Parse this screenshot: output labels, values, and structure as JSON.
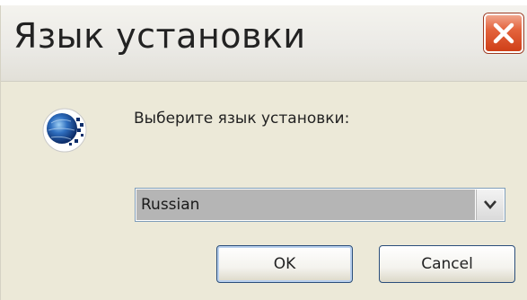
{
  "window": {
    "title": "Язык установки",
    "close_icon": "close-x-icon",
    "accent_close": "#d84a21"
  },
  "content": {
    "icon": "globe-icon",
    "prompt": "Выберите язык установки:"
  },
  "language_select": {
    "selected": "Russian",
    "arrow_icon": "chevron-down-icon"
  },
  "buttons": {
    "ok_label": "OK",
    "cancel_label": "Cancel"
  }
}
